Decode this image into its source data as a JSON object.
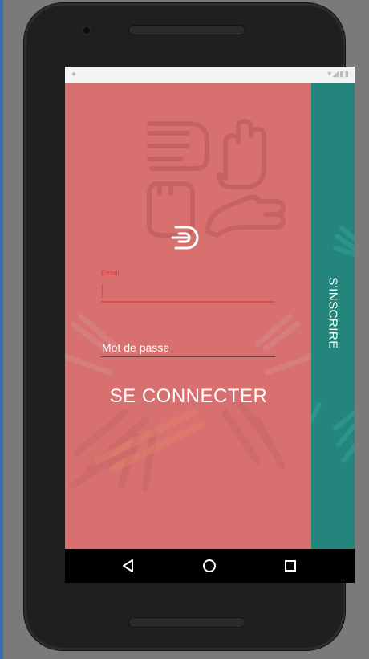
{
  "login": {
    "email_label": "Email",
    "email_value": "",
    "password_placeholder": "Mot de passe",
    "submit_label": "SE CONNECTER"
  },
  "side_panel": {
    "register_label": "S'INSCRIRE"
  },
  "icons": {
    "logo": "hand-pointing-target-logo",
    "back": "back-triangle-icon",
    "home": "home-circle-icon",
    "recents": "recents-square-icon"
  },
  "colors": {
    "main_panel": "#d87070",
    "side_panel": "#23857c",
    "email_accent": "#e23b3b",
    "text": "#ffffff"
  }
}
